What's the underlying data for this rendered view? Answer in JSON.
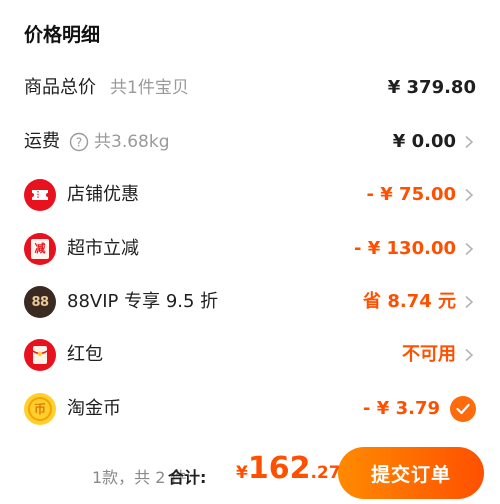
{
  "title": "价格明细",
  "rows": {
    "goods": {
      "label": "商品总价",
      "sub": "共1件宝贝",
      "value": "¥ 379.80"
    },
    "shipping": {
      "label": "运费",
      "sub": "共3.68kg",
      "value": "¥ 0.00"
    },
    "shop_discount": {
      "label": "店铺优惠",
      "value": "- ¥ 75.00"
    },
    "market_cut": {
      "label": "超市立减",
      "value": "- ¥ 130.00",
      "icon_text": "减"
    },
    "vip": {
      "label": "88VIP 专享 9.5 折",
      "value": "省 8.74 元",
      "icon_text": "88"
    },
    "red_packet": {
      "label": "红包",
      "value": "不可用"
    },
    "coins": {
      "label": "淘金币",
      "value": "- ¥ 3.79",
      "icon_text": "币"
    }
  },
  "footer": {
    "count": "1款，共 2 件",
    "total_label": "合计:",
    "currency": "¥",
    "price_int": "162",
    "price_dec": ".27",
    "submit": "提交订单"
  },
  "colors": {
    "accent": "#ff5000",
    "red_icon": "#e8121f",
    "vip_icon": "#3a2a22",
    "coin_icon": "#ffcf2e",
    "check": "#ff6a0c"
  },
  "icons": {
    "help": "question-circle-icon",
    "chevron": "chevron-right-icon",
    "check": "check-circle-icon"
  }
}
